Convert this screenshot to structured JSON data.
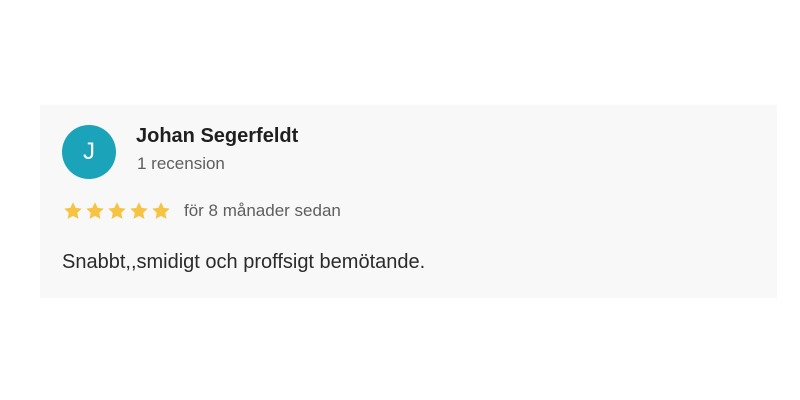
{
  "review": {
    "avatar_initial": "J",
    "avatar_color": "#1aa3b9",
    "reviewer_name": "Johan Segerfeldt",
    "review_count": "1 recension",
    "rating": 5,
    "rating_max": 5,
    "star_color": "#f6c343",
    "time_ago": "för 8 månader sedan",
    "text": "Snabbt,,smidigt och proffsigt bemötande."
  }
}
